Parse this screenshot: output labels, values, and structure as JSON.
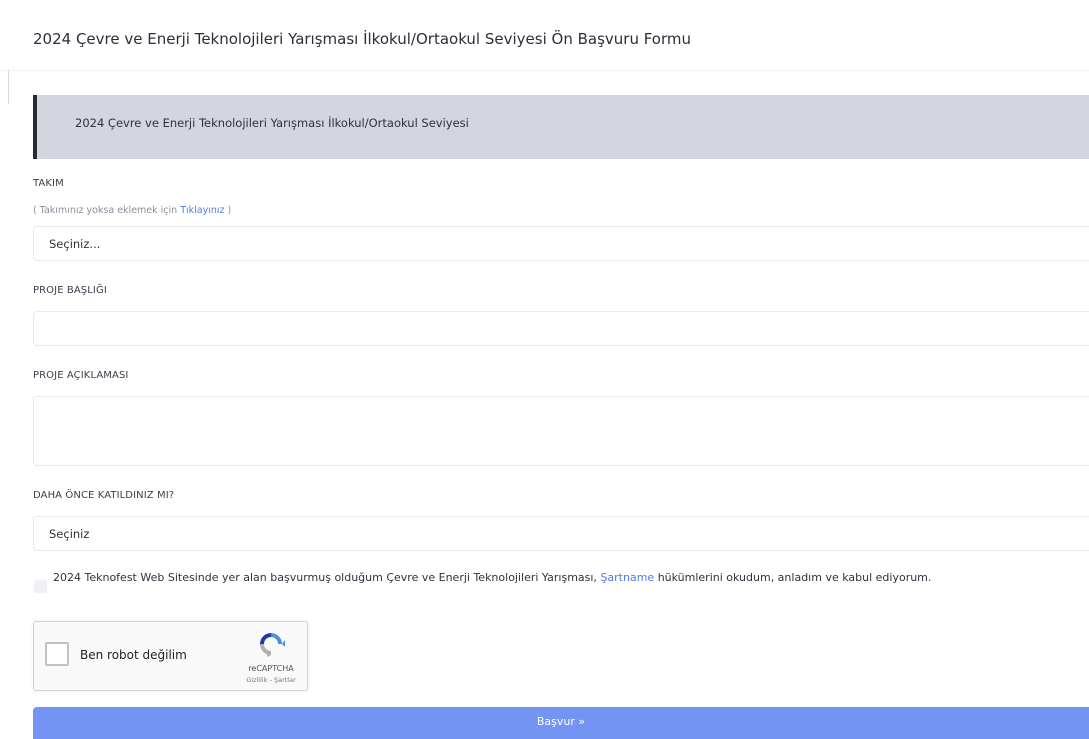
{
  "page_title": "2024 Çevre ve Enerji Teknolojileri Yarışması İlkokul/Ortaokul Seviyesi Ön Başvuru Formu",
  "banner_text": "2024 Çevre ve Enerji Teknolojileri Yarışması İlkokul/Ortaokul Seviyesi",
  "team": {
    "label": "TAKIM",
    "hint_prefix": "( Takımınız yoksa eklemek için ",
    "hint_link": "Tıklayınız",
    "hint_suffix": " )",
    "selected": "Seçiniz..."
  },
  "project_title": {
    "label": "PROJE BAŞLIĞI",
    "value": ""
  },
  "project_description": {
    "label": "PROJE AÇIKLAMASI",
    "value": ""
  },
  "participated_before": {
    "label": "DAHA ÖNCE KATILDINIZ MI?",
    "selected": "Seçiniz"
  },
  "consent": {
    "prefix": "2024 Teknofest Web Sitesinde yer alan başvurmuş olduğum Çevre ve Enerji Teknolojileri Yarışması, ",
    "link": "Şartname",
    "suffix": " hükümlerini okudum, anladım ve kabul ediyorum."
  },
  "recaptcha": {
    "label": "Ben robot değilim",
    "brand": "reCAPTCHA",
    "terms": "Gizlilik - Şartlar"
  },
  "submit_label": "Başvur »",
  "colors": {
    "accent": "#7494f4",
    "link": "#4f7de6",
    "banner_bg": "#d3d6de",
    "banner_border": "#262a33"
  }
}
